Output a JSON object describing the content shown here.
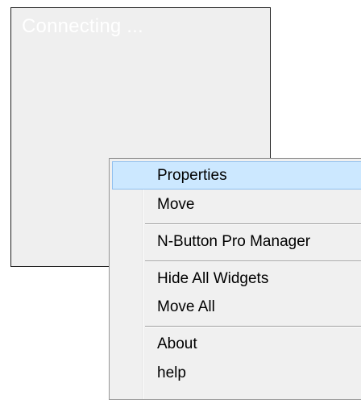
{
  "widget": {
    "status_text": "Connecting ..."
  },
  "context_menu": {
    "items": [
      {
        "label": "Properties",
        "highlighted": true
      },
      {
        "label": "Move"
      },
      {
        "label": "N-Button Pro Manager"
      },
      {
        "label": "Hide All Widgets"
      },
      {
        "label": "Move All"
      },
      {
        "label": "About"
      },
      {
        "label": "help"
      }
    ]
  },
  "colors": {
    "widget_bg": "#efefef",
    "menu_bg": "#f0f0f0",
    "highlight_bg": "#cce8ff",
    "highlight_border": "#8fbfef"
  }
}
